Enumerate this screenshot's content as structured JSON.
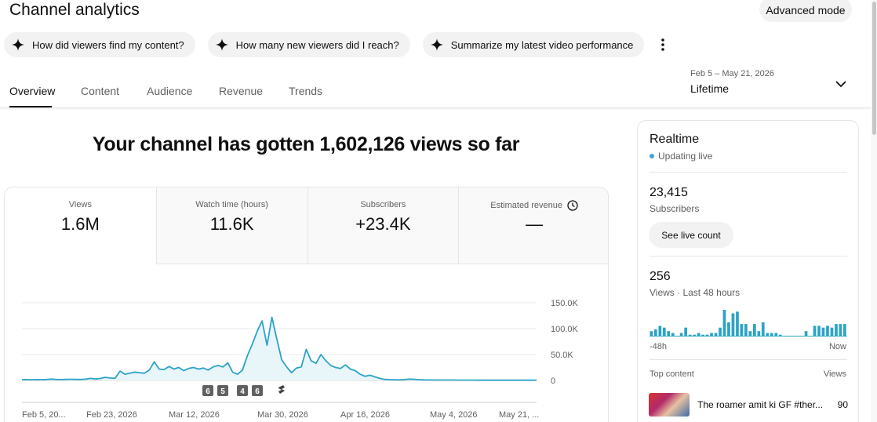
{
  "header": {
    "title": "Channel analytics",
    "advanced_mode": "Advanced mode"
  },
  "chips": [
    {
      "label": "How did viewers find my content?"
    },
    {
      "label": "How many new viewers did I reach?"
    },
    {
      "label": "Summarize my latest video performance"
    }
  ],
  "tabs": [
    {
      "label": "Overview",
      "active": true
    },
    {
      "label": "Content",
      "active": false
    },
    {
      "label": "Audience",
      "active": false
    },
    {
      "label": "Revenue",
      "active": false
    },
    {
      "label": "Trends",
      "active": false
    }
  ],
  "date_range": {
    "range": "Feb 5 – May 21, 2026",
    "label": "Lifetime"
  },
  "headline": "Your channel has gotten 1,602,126 views so far",
  "metrics": [
    {
      "label": "Views",
      "value": "1.6M"
    },
    {
      "label": "Watch time (hours)",
      "value": "11.6K"
    },
    {
      "label": "Subscribers",
      "value": "+23.4K"
    },
    {
      "label": "Estimated revenue",
      "value": "—"
    }
  ],
  "chart_data": {
    "type": "area",
    "series": [
      {
        "values": [
          1500,
          1600,
          1400,
          1700,
          1500,
          1800,
          2500,
          1800,
          1600,
          2000,
          2200,
          1900,
          1800,
          2500,
          4000,
          2800,
          3800,
          6000,
          4500,
          4200,
          18000,
          12000,
          14000,
          16000,
          15000,
          14000,
          20000,
          36000,
          22000,
          21000,
          27000,
          22000,
          25000,
          19000,
          23000,
          25000,
          22000,
          24000,
          20000,
          26000,
          29000,
          26000,
          34000,
          16000,
          12000,
          20000,
          48000,
          70000,
          95000,
          115000,
          68000,
          122000,
          80000,
          40000,
          26000,
          15000,
          24000,
          26000,
          60000,
          38000,
          33000,
          50000,
          38000,
          29000,
          25000,
          23000,
          30000,
          22000,
          19000,
          12000,
          8000,
          10000,
          7000,
          4000,
          2000,
          1500,
          1200,
          1000,
          1500,
          2500,
          2200,
          1500,
          1100,
          900,
          800,
          800,
          700,
          700,
          700,
          600,
          600,
          600,
          600,
          500,
          500,
          500,
          500,
          500,
          500,
          500,
          500,
          500,
          500,
          500,
          500,
          500
        ]
      }
    ],
    "x_ticks": [
      "Feb 5, 20...",
      "Feb 23, 2026",
      "Mar 12, 2026",
      "Mar 30, 2026",
      "Apr 16, 2026",
      "May 4, 2026",
      "May 21, ..."
    ],
    "y_ticks": [
      "150.0K",
      "100.0K",
      "50.0K",
      "0"
    ],
    "ylim": [
      0,
      150000
    ],
    "grid": true,
    "markers": [
      "6",
      "5",
      "4",
      "6"
    ],
    "color": "#2ba3c7",
    "fill": "#e8f5f9"
  },
  "realtime": {
    "title": "Realtime",
    "status": "Updating live",
    "subscribers": "23,415",
    "subscribers_label": "Subscribers",
    "live_count_button": "See live count",
    "views": "256",
    "views_label": "Views · Last 48 hours",
    "bars": [
      3,
      4,
      6,
      5,
      3,
      2,
      0,
      2,
      5,
      1,
      1,
      2,
      1,
      1,
      2,
      2,
      5,
      15,
      8,
      13,
      14,
      7,
      7,
      3,
      7,
      3,
      8,
      2,
      2,
      2,
      1,
      0,
      0,
      0,
      0,
      0,
      3,
      0,
      6,
      6,
      5,
      6,
      5,
      7,
      7,
      7
    ],
    "axis_left": "-48h",
    "axis_right": "Now",
    "top_content_label": "Top content",
    "views_col_label": "Views",
    "top_items": [
      {
        "title": "The roamer amit ki GF #ther...",
        "views": "90"
      }
    ]
  }
}
